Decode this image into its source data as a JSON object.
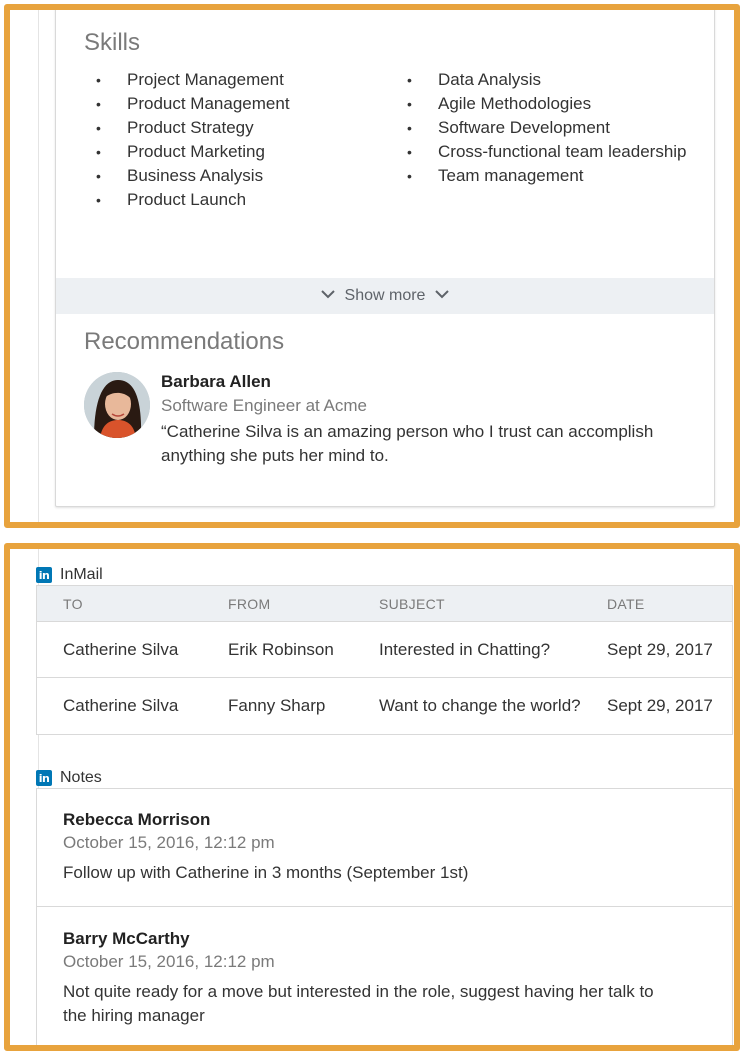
{
  "skills": {
    "title": "Skills",
    "column1": [
      "Project Management",
      "Product Management",
      "Product Strategy",
      "Product Marketing",
      "Business Analysis",
      "Product Launch"
    ],
    "column2": [
      "Data Analysis",
      "Agile Methodologies",
      "Software Development",
      "Cross-functional team leadership",
      "Team management"
    ],
    "show_more_label": "Show more",
    "show_more_icon": "chevron-down-icon"
  },
  "recommendations": {
    "title": "Recommendations",
    "items": [
      {
        "name": "Barbara Allen",
        "role": "Software Engineer at Acme",
        "quote": "“Catherine Silva is an amazing person who I trust can accomplish anything she puts her mind to."
      }
    ]
  },
  "inmail": {
    "title": "InMail",
    "logo_text": "in",
    "columns": [
      "TO",
      "FROM",
      "SUBJECT",
      "DATE"
    ],
    "rows": [
      [
        "Catherine Silva",
        "Erik Robinson",
        "Interested in Chatting?",
        "Sept 29, 2017"
      ],
      [
        "Catherine Silva",
        "Fanny Sharp",
        "Want to change the world?",
        "Sept 29, 2017"
      ]
    ]
  },
  "notes": {
    "title": "Notes",
    "logo_text": "in",
    "items": [
      {
        "author": "Rebecca Morrison",
        "date": "October 15, 2016, 12:12 pm",
        "text": "Follow up with Catherine in 3 months (September 1st)"
      },
      {
        "author": "Barry McCarthy",
        "date": "October 15, 2016, 12:12 pm",
        "text": "Not quite ready for a move but interested in the role, suggest having her talk to the hiring manager"
      }
    ]
  },
  "colors": {
    "highlight": "#E8A33D",
    "linkedin_blue": "#0077B5",
    "bar_gray": "#edf0f3"
  }
}
